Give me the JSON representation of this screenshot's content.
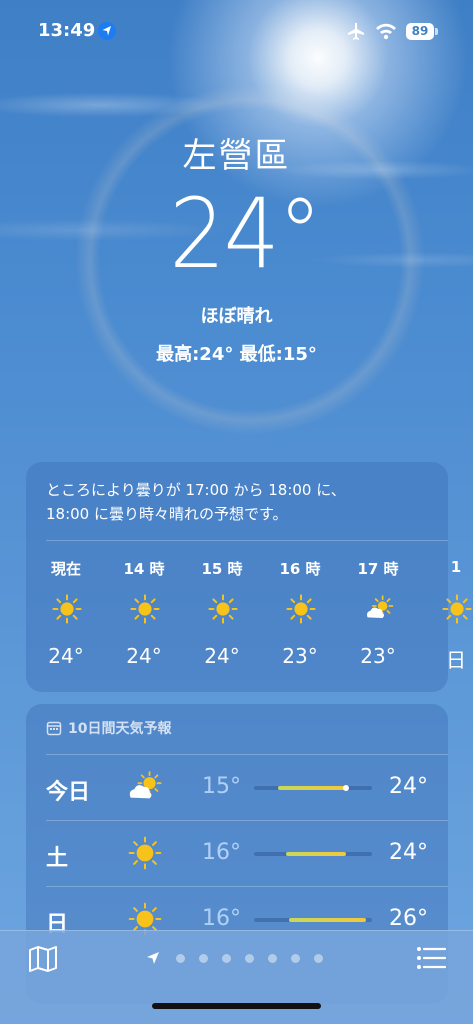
{
  "status_bar": {
    "time": "13:49",
    "battery": "89"
  },
  "location": {
    "city": "左營區",
    "temperature": "24°",
    "condition": "ほぼ晴れ",
    "high_low": "最高:24°  最低:15°"
  },
  "hourly": {
    "summary_line1": "ところにより曇りが 17:00 から 18:00 に、",
    "summary_line2": "18:00 に曇り時々晴れの予想です。",
    "hours": [
      {
        "label": "現在",
        "icon": "sun-icon",
        "temp": "24°"
      },
      {
        "label": "14 時",
        "icon": "sun-icon",
        "temp": "24°"
      },
      {
        "label": "15 時",
        "icon": "sun-icon",
        "temp": "24°"
      },
      {
        "label": "16 時",
        "icon": "sun-icon",
        "temp": "23°"
      },
      {
        "label": "17 時",
        "icon": "partly-cloudy-icon",
        "temp": "23°"
      },
      {
        "label": "1",
        "icon": "sun-icon",
        "temp": "日"
      }
    ]
  },
  "daily": {
    "header": "10日間天気予報",
    "days": [
      {
        "name": "今日",
        "icon": "partly-cloudy-icon",
        "low": "15°",
        "high": "24°",
        "range_start": 0.2,
        "range_end": 0.78,
        "current": 0.78
      },
      {
        "name": "土",
        "icon": "sun-icon",
        "low": "16°",
        "high": "24°",
        "range_start": 0.27,
        "range_end": 0.78
      },
      {
        "name": "日",
        "icon": "sun-icon",
        "low": "16°",
        "high": "26°",
        "range_start": 0.3,
        "range_end": 0.95
      }
    ]
  },
  "toolbar": {
    "page_count": 7
  },
  "colors": {
    "sun": "#f7c21a",
    "accent_bar": "#f2c83a",
    "location_blue": "#1e7cf2"
  }
}
